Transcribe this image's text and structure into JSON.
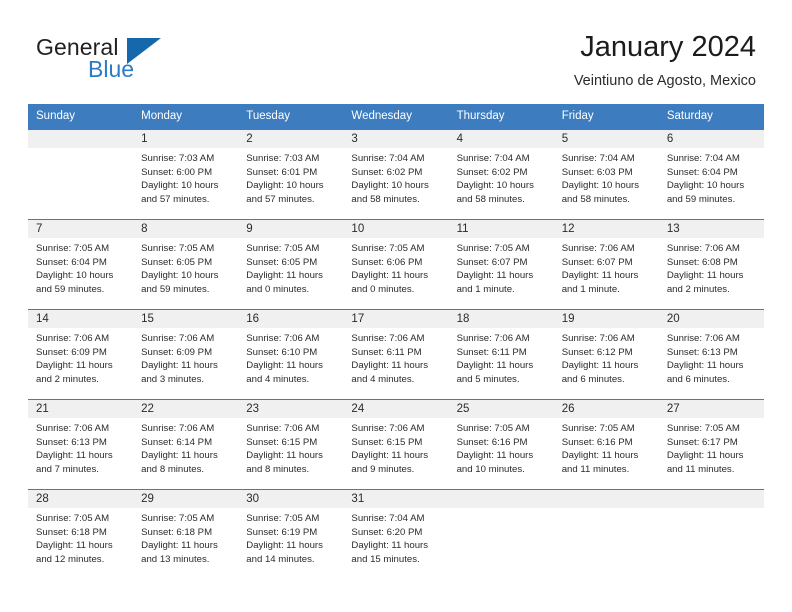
{
  "brand": {
    "name_part1": "General",
    "name_part2": "Blue",
    "triangle_icon": "triangle-icon",
    "accent_color": "#2b7cc4",
    "header_color": "#3c7cbf"
  },
  "header": {
    "title": "January 2024",
    "subtitle": "Veintiuno de Agosto, Mexico"
  },
  "weekdays": [
    "Sunday",
    "Monday",
    "Tuesday",
    "Wednesday",
    "Thursday",
    "Friday",
    "Saturday"
  ],
  "weeks": [
    [
      {
        "day": "",
        "lines": []
      },
      {
        "day": "1",
        "lines": [
          "Sunrise: 7:03 AM",
          "Sunset: 6:00 PM",
          "Daylight: 10 hours",
          "and 57 minutes."
        ]
      },
      {
        "day": "2",
        "lines": [
          "Sunrise: 7:03 AM",
          "Sunset: 6:01 PM",
          "Daylight: 10 hours",
          "and 57 minutes."
        ]
      },
      {
        "day": "3",
        "lines": [
          "Sunrise: 7:04 AM",
          "Sunset: 6:02 PM",
          "Daylight: 10 hours",
          "and 58 minutes."
        ]
      },
      {
        "day": "4",
        "lines": [
          "Sunrise: 7:04 AM",
          "Sunset: 6:02 PM",
          "Daylight: 10 hours",
          "and 58 minutes."
        ]
      },
      {
        "day": "5",
        "lines": [
          "Sunrise: 7:04 AM",
          "Sunset: 6:03 PM",
          "Daylight: 10 hours",
          "and 58 minutes."
        ]
      },
      {
        "day": "6",
        "lines": [
          "Sunrise: 7:04 AM",
          "Sunset: 6:04 PM",
          "Daylight: 10 hours",
          "and 59 minutes."
        ]
      }
    ],
    [
      {
        "day": "7",
        "lines": [
          "Sunrise: 7:05 AM",
          "Sunset: 6:04 PM",
          "Daylight: 10 hours",
          "and 59 minutes."
        ]
      },
      {
        "day": "8",
        "lines": [
          "Sunrise: 7:05 AM",
          "Sunset: 6:05 PM",
          "Daylight: 10 hours",
          "and 59 minutes."
        ]
      },
      {
        "day": "9",
        "lines": [
          "Sunrise: 7:05 AM",
          "Sunset: 6:05 PM",
          "Daylight: 11 hours",
          "and 0 minutes."
        ]
      },
      {
        "day": "10",
        "lines": [
          "Sunrise: 7:05 AM",
          "Sunset: 6:06 PM",
          "Daylight: 11 hours",
          "and 0 minutes."
        ]
      },
      {
        "day": "11",
        "lines": [
          "Sunrise: 7:05 AM",
          "Sunset: 6:07 PM",
          "Daylight: 11 hours",
          "and 1 minute."
        ]
      },
      {
        "day": "12",
        "lines": [
          "Sunrise: 7:06 AM",
          "Sunset: 6:07 PM",
          "Daylight: 11 hours",
          "and 1 minute."
        ]
      },
      {
        "day": "13",
        "lines": [
          "Sunrise: 7:06 AM",
          "Sunset: 6:08 PM",
          "Daylight: 11 hours",
          "and 2 minutes."
        ]
      }
    ],
    [
      {
        "day": "14",
        "lines": [
          "Sunrise: 7:06 AM",
          "Sunset: 6:09 PM",
          "Daylight: 11 hours",
          "and 2 minutes."
        ]
      },
      {
        "day": "15",
        "lines": [
          "Sunrise: 7:06 AM",
          "Sunset: 6:09 PM",
          "Daylight: 11 hours",
          "and 3 minutes."
        ]
      },
      {
        "day": "16",
        "lines": [
          "Sunrise: 7:06 AM",
          "Sunset: 6:10 PM",
          "Daylight: 11 hours",
          "and 4 minutes."
        ]
      },
      {
        "day": "17",
        "lines": [
          "Sunrise: 7:06 AM",
          "Sunset: 6:11 PM",
          "Daylight: 11 hours",
          "and 4 minutes."
        ]
      },
      {
        "day": "18",
        "lines": [
          "Sunrise: 7:06 AM",
          "Sunset: 6:11 PM",
          "Daylight: 11 hours",
          "and 5 minutes."
        ]
      },
      {
        "day": "19",
        "lines": [
          "Sunrise: 7:06 AM",
          "Sunset: 6:12 PM",
          "Daylight: 11 hours",
          "and 6 minutes."
        ]
      },
      {
        "day": "20",
        "lines": [
          "Sunrise: 7:06 AM",
          "Sunset: 6:13 PM",
          "Daylight: 11 hours",
          "and 6 minutes."
        ]
      }
    ],
    [
      {
        "day": "21",
        "lines": [
          "Sunrise: 7:06 AM",
          "Sunset: 6:13 PM",
          "Daylight: 11 hours",
          "and 7 minutes."
        ]
      },
      {
        "day": "22",
        "lines": [
          "Sunrise: 7:06 AM",
          "Sunset: 6:14 PM",
          "Daylight: 11 hours",
          "and 8 minutes."
        ]
      },
      {
        "day": "23",
        "lines": [
          "Sunrise: 7:06 AM",
          "Sunset: 6:15 PM",
          "Daylight: 11 hours",
          "and 8 minutes."
        ]
      },
      {
        "day": "24",
        "lines": [
          "Sunrise: 7:06 AM",
          "Sunset: 6:15 PM",
          "Daylight: 11 hours",
          "and 9 minutes."
        ]
      },
      {
        "day": "25",
        "lines": [
          "Sunrise: 7:05 AM",
          "Sunset: 6:16 PM",
          "Daylight: 11 hours",
          "and 10 minutes."
        ]
      },
      {
        "day": "26",
        "lines": [
          "Sunrise: 7:05 AM",
          "Sunset: 6:16 PM",
          "Daylight: 11 hours",
          "and 11 minutes."
        ]
      },
      {
        "day": "27",
        "lines": [
          "Sunrise: 7:05 AM",
          "Sunset: 6:17 PM",
          "Daylight: 11 hours",
          "and 11 minutes."
        ]
      }
    ],
    [
      {
        "day": "28",
        "lines": [
          "Sunrise: 7:05 AM",
          "Sunset: 6:18 PM",
          "Daylight: 11 hours",
          "and 12 minutes."
        ]
      },
      {
        "day": "29",
        "lines": [
          "Sunrise: 7:05 AM",
          "Sunset: 6:18 PM",
          "Daylight: 11 hours",
          "and 13 minutes."
        ]
      },
      {
        "day": "30",
        "lines": [
          "Sunrise: 7:05 AM",
          "Sunset: 6:19 PM",
          "Daylight: 11 hours",
          "and 14 minutes."
        ]
      },
      {
        "day": "31",
        "lines": [
          "Sunrise: 7:04 AM",
          "Sunset: 6:20 PM",
          "Daylight: 11 hours",
          "and 15 minutes."
        ]
      },
      {
        "day": "",
        "lines": []
      },
      {
        "day": "",
        "lines": []
      },
      {
        "day": "",
        "lines": []
      }
    ]
  ]
}
